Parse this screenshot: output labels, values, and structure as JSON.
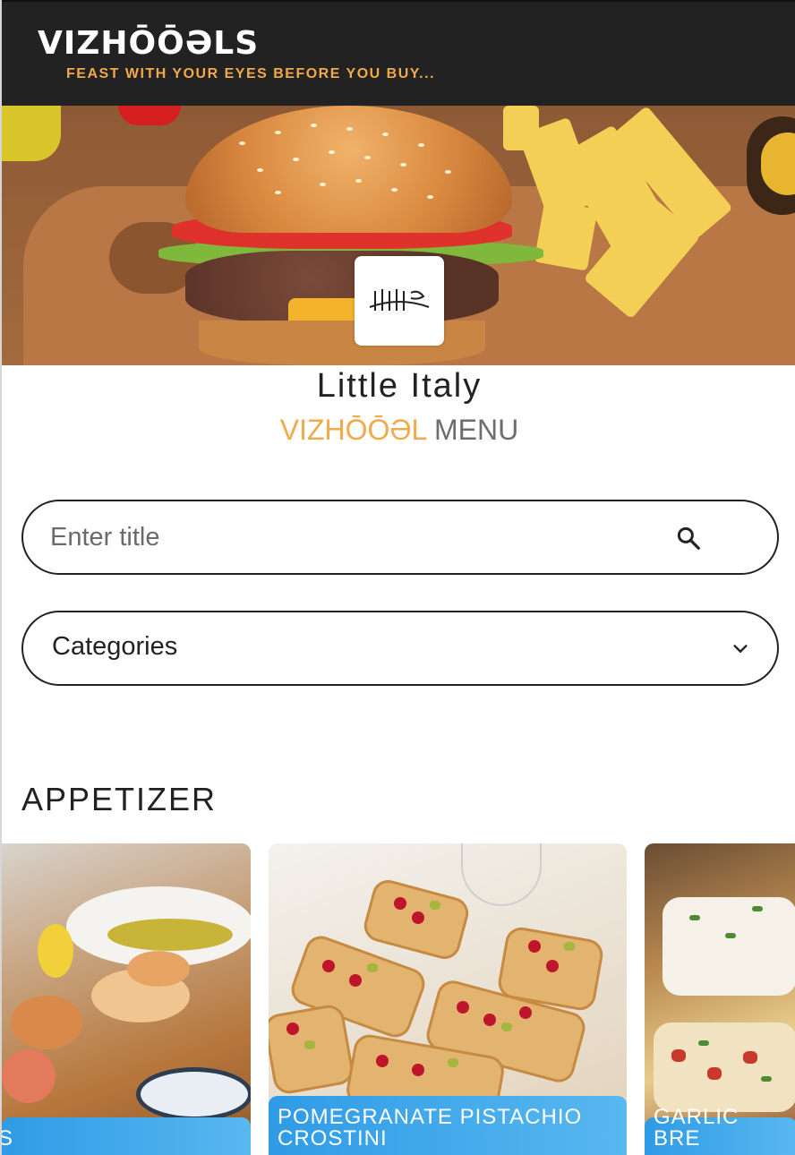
{
  "header": {
    "brand": "VIZHŌŌƏLS",
    "tagline": "FEAST WITH YOUR EYES BEFORE YOU BUY..."
  },
  "restaurant": {
    "name": "Little Italy",
    "menu_accent": "VIZHŌŌƏL",
    "menu_word": "MENU"
  },
  "search": {
    "placeholder": "Enter title",
    "value": ""
  },
  "categories": {
    "label": "Categories"
  },
  "section": {
    "title": "APPETIZER"
  },
  "cards": [
    {
      "label": "S"
    },
    {
      "label": "POMEGRANATE PISTACHIO CROSTINI"
    },
    {
      "label": "GARLIC BRE"
    }
  ],
  "colors": {
    "header_bg": "#222222",
    "accent": "#f2a94a",
    "card_label": "#2f9be6"
  }
}
